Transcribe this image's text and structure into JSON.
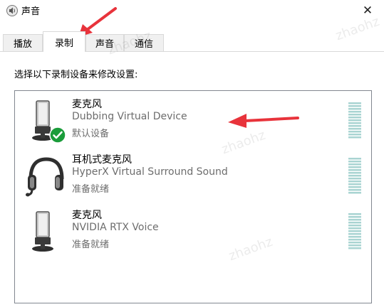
{
  "window": {
    "title": "声音",
    "close_glyph": "✕"
  },
  "tabs": [
    {
      "label": "播放",
      "selected": false
    },
    {
      "label": "录制",
      "selected": true
    },
    {
      "label": "声音",
      "selected": false
    },
    {
      "label": "通信",
      "selected": false
    }
  ],
  "instruction": "选择以下录制设备来修改设置:",
  "devices": [
    {
      "name": "麦克风",
      "description": "Dubbing Virtual Device",
      "status": "默认设备",
      "icon": "microphone-icon",
      "default": true
    },
    {
      "name": "耳机式麦克风",
      "description": "HyperX Virtual Surround Sound",
      "status": "准备就绪",
      "icon": "headset-icon",
      "default": false
    },
    {
      "name": "麦克风",
      "description": "NVIDIA RTX Voice",
      "status": "准备就绪",
      "icon": "microphone-icon",
      "default": false
    }
  ],
  "watermark": "zhaohz",
  "colors": {
    "meter": "#a9d4d2",
    "default_badge": "#1a9c3a",
    "annotation_arrow": "#e8333b"
  }
}
